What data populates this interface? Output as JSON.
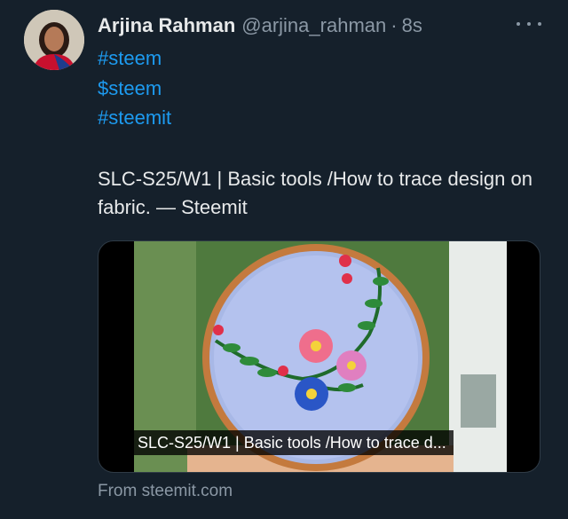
{
  "author": {
    "name": "Arjina Rahman",
    "handle": "@arjina_rahman",
    "separator": "·",
    "time": "8s"
  },
  "hashtags": [
    "#steem",
    "$steem",
    "#steemit"
  ],
  "tweet_text": "SLC-S25/W1 | Basic tools /How to trace design on fabric. — Steemit",
  "link_card": {
    "title": "SLC-S25/W1 | Basic tools /How to trace d...",
    "source": "From steemit.com"
  },
  "icons": {
    "avatar": "avatar-photo",
    "more": "more-icon"
  },
  "colors": {
    "background": "#15202b",
    "link": "#1d9bf0",
    "muted": "#8b98a5",
    "text": "#e7e9ea"
  }
}
